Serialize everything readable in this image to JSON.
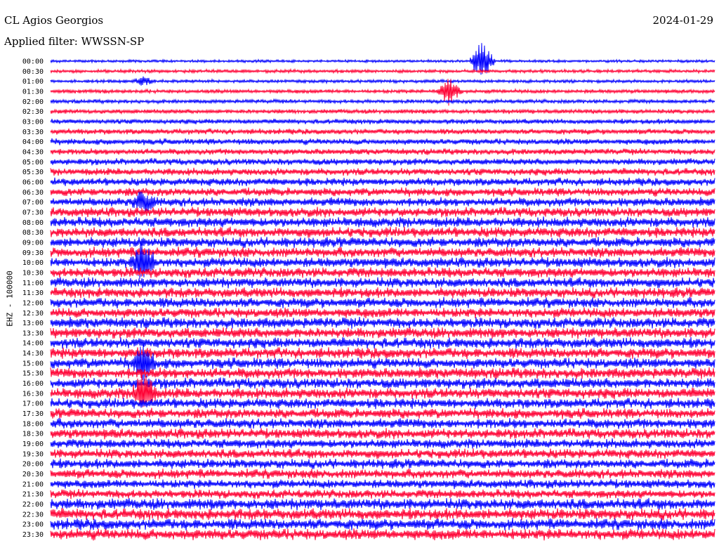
{
  "header": {
    "station": "CL Agios Georgios",
    "filter": "Applied filter: WWSSN-SP",
    "date": "2024-01-29"
  },
  "channel_label": "EHZ - 100000",
  "colors": {
    "trace_a": "#0000ff",
    "trace_b": "#ff0033",
    "background": "#ffffff"
  },
  "chart_data": {
    "type": "line",
    "title": "CL Agios Georgios",
    "subtitle": "Applied filter: WWSSN-SP",
    "ylabel": "EHZ - 100000",
    "row_labels": [
      "00:00",
      "00:30",
      "01:00",
      "01:30",
      "02:00",
      "02:30",
      "03:00",
      "03:30",
      "04:00",
      "04:30",
      "05:00",
      "05:30",
      "06:00",
      "06:30",
      "07:00",
      "07:30",
      "08:00",
      "08:30",
      "09:00",
      "09:30",
      "10:00",
      "10:30",
      "11:00",
      "11:30",
      "12:00",
      "12:30",
      "13:00",
      "13:30",
      "14:00",
      "14:30",
      "15:00",
      "15:30",
      "16:00",
      "16:30",
      "17:00",
      "17:30",
      "18:00",
      "18:30",
      "19:00",
      "19:30",
      "20:00",
      "20:30",
      "21:00",
      "21:30",
      "22:00",
      "22:30",
      "23:00",
      "23:30"
    ],
    "series_colors": [
      "#0000ff",
      "#ff0033"
    ],
    "noise_level": [
      0.25,
      0.3,
      0.3,
      0.35,
      0.35,
      0.4,
      0.45,
      0.5,
      0.55,
      0.55,
      0.6,
      0.65,
      0.7,
      0.75,
      0.8,
      0.85,
      0.9,
      0.9,
      0.9,
      0.9,
      0.9,
      0.9,
      0.9,
      0.9,
      0.9,
      0.9,
      0.95,
      0.95,
      0.95,
      0.95,
      0.95,
      0.95,
      0.95,
      0.95,
      0.9,
      0.9,
      0.9,
      0.9,
      0.85,
      0.85,
      0.85,
      0.85,
      0.8,
      0.8,
      1.0,
      1.0,
      1.0,
      1.0
    ],
    "events": [
      {
        "row": 0,
        "time_min": 19.5,
        "amplitude": 3.0
      },
      {
        "row": 3,
        "time_min": 18.0,
        "amplitude": 2.0
      },
      {
        "row": 2,
        "time_min": 4.2,
        "amplitude": 0.5
      },
      {
        "row": 14,
        "time_min": 4.2,
        "amplitude": 1.5
      },
      {
        "row": 20,
        "time_min": 4.2,
        "amplitude": 3.0
      },
      {
        "row": 30,
        "time_min": 4.2,
        "amplitude": 2.5
      },
      {
        "row": 33,
        "time_min": 4.2,
        "amplitude": 3.0
      }
    ],
    "minutes_per_row": 30,
    "grid": false
  }
}
